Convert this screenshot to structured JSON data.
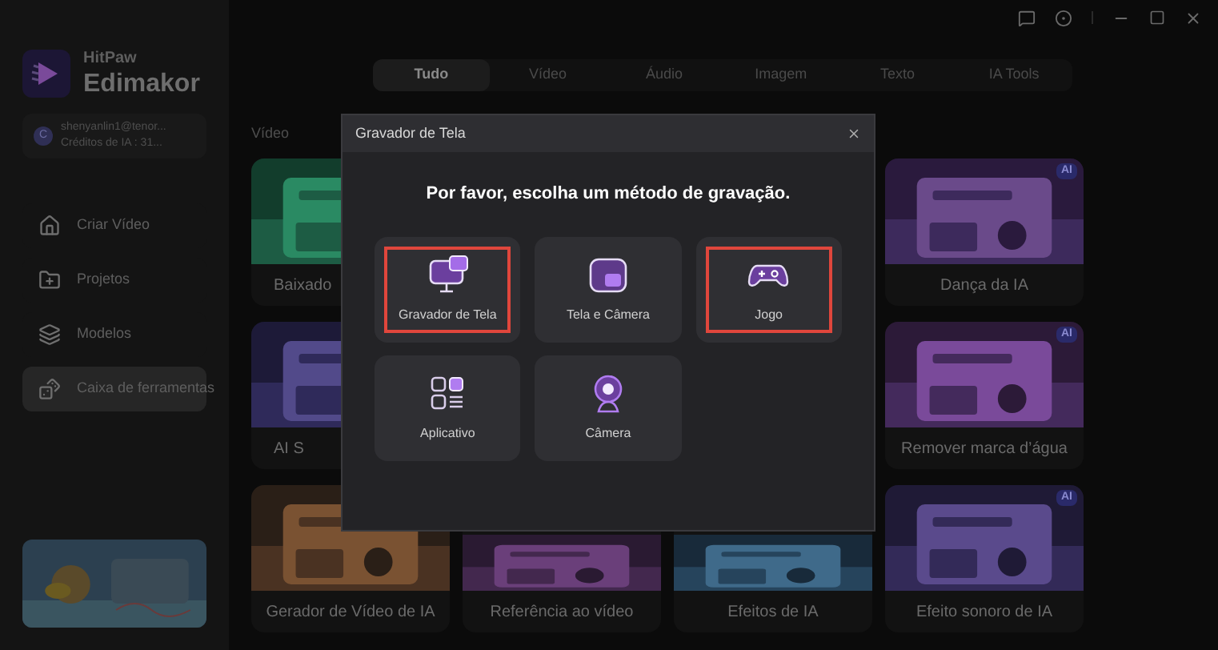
{
  "app": {
    "brand_small": "HitPaw",
    "brand_large": "Edimakor"
  },
  "account": {
    "avatar": "C",
    "email": "shenyanlin1@tenor...",
    "credits": "Créditos de IA : 31..."
  },
  "sidebar": {
    "items": [
      {
        "label": "Criar Vídeo",
        "kind": "create",
        "selected": false
      },
      {
        "label": "Projetos",
        "kind": "projects",
        "selected": false
      },
      {
        "label": "Modelos",
        "kind": "templates",
        "selected": false
      },
      {
        "label": "Caixa de ferramentas",
        "kind": "toolbox",
        "selected": true
      }
    ]
  },
  "tabs": [
    {
      "label": "Tudo",
      "selected": true
    },
    {
      "label": "Vídeo",
      "selected": false
    },
    {
      "label": "Áudio",
      "selected": false
    },
    {
      "label": "Imagem",
      "selected": false
    },
    {
      "label": "Texto",
      "selected": false
    },
    {
      "label": "IA Tools",
      "selected": false
    }
  ],
  "section": {
    "title": "Vídeo"
  },
  "card_rows": [
    {
      "cards": [
        {
          "label": "Baixado"
        },
        {
          "label": "Dança da IA",
          "badge": "AI"
        }
      ]
    },
    {
      "cards": [
        {
          "label": "AI S"
        },
        {
          "label": "Remover marca d’água",
          "badge": "AI"
        }
      ]
    },
    {
      "cards": [
        {
          "label": "Gerador de Vídeo de IA"
        },
        {
          "label": "Referência ao vídeo"
        },
        {
          "label": "Efeitos de IA"
        },
        {
          "label": "Efeito sonoro de IA",
          "badge": "AI"
        }
      ]
    }
  ],
  "dialog": {
    "title": "Gravador de Tela",
    "heading": "Por favor, escolha um método de gravação.",
    "options": [
      {
        "label": "Gravador de Tela",
        "kind": "screen",
        "highlighted": true
      },
      {
        "label": "Tela e Câmera",
        "kind": "screen-camera",
        "highlighted": false
      },
      {
        "label": "Jogo",
        "kind": "game",
        "highlighted": true
      },
      {
        "label": "Aplicativo",
        "kind": "app",
        "highlighted": false
      },
      {
        "label": "Câmera",
        "kind": "camera",
        "highlighted": false
      }
    ]
  }
}
